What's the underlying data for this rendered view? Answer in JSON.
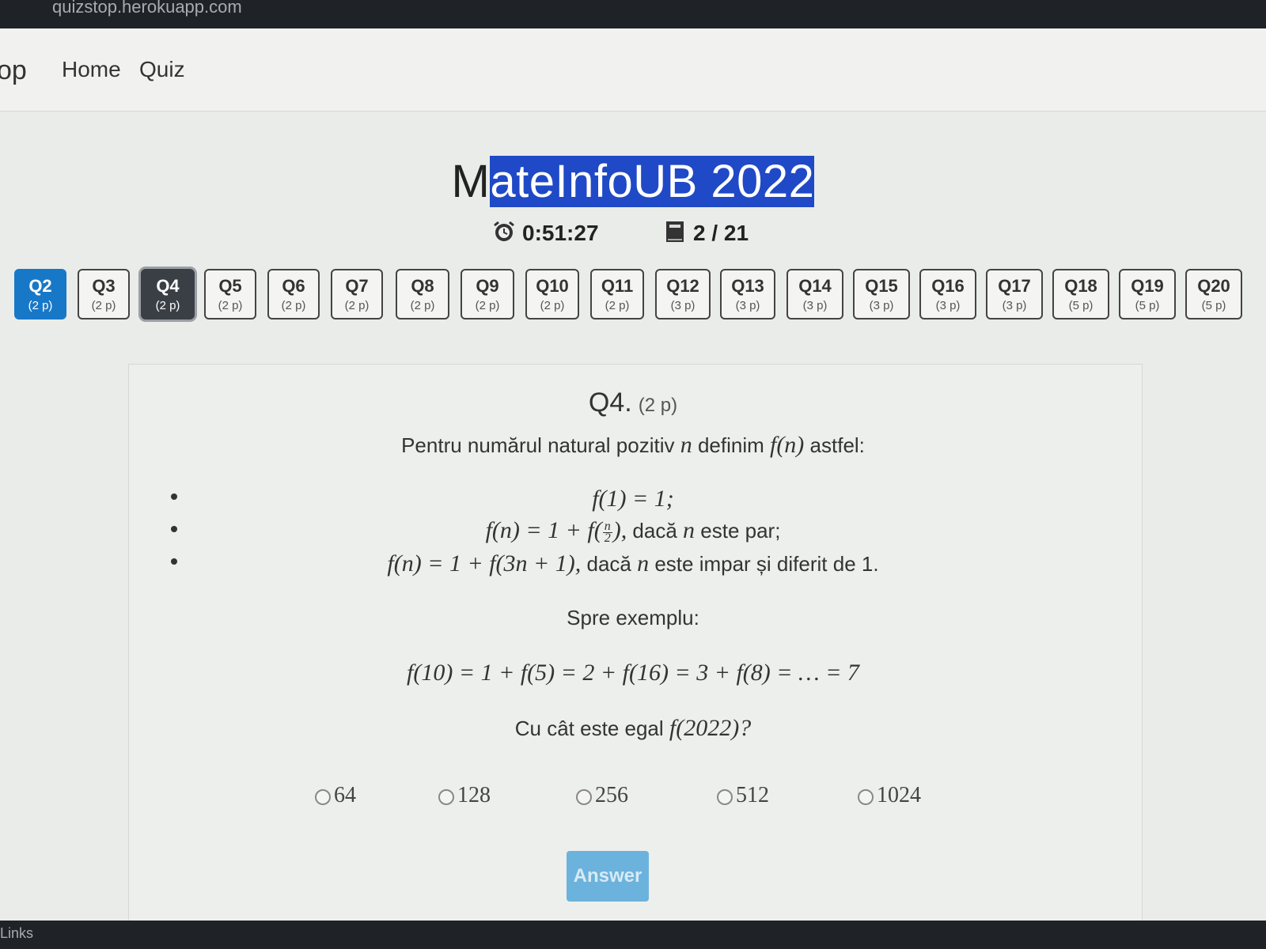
{
  "browser": {
    "url": "quizstop.herokuapp.com"
  },
  "navbar": {
    "brand": "op",
    "links": [
      "Home",
      "Quiz"
    ]
  },
  "quiz": {
    "title_prefix": "M",
    "title_selected": "ateInfoUB 2022",
    "timer": "0:51:27",
    "progress": "2 / 21"
  },
  "questions_nav": [
    {
      "label": "Q2",
      "points": "(2 p)",
      "state": "answered"
    },
    {
      "label": "Q3",
      "points": "(2 p)",
      "state": "default"
    },
    {
      "label": "Q4",
      "points": "(2 p)",
      "state": "current"
    },
    {
      "label": "Q5",
      "points": "(2 p)",
      "state": "default"
    },
    {
      "label": "Q6",
      "points": "(2 p)",
      "state": "default"
    },
    {
      "label": "Q7",
      "points": "(2 p)",
      "state": "default"
    },
    {
      "label": "Q8",
      "points": "(2 p)",
      "state": "default"
    },
    {
      "label": "Q9",
      "points": "(2 p)",
      "state": "default"
    },
    {
      "label": "Q10",
      "points": "(2 p)",
      "state": "default"
    },
    {
      "label": "Q11",
      "points": "(2 p)",
      "state": "default"
    },
    {
      "label": "Q12",
      "points": "(3 p)",
      "state": "default"
    },
    {
      "label": "Q13",
      "points": "(3 p)",
      "state": "default"
    },
    {
      "label": "Q14",
      "points": "(3 p)",
      "state": "default"
    },
    {
      "label": "Q15",
      "points": "(3 p)",
      "state": "default"
    },
    {
      "label": "Q16",
      "points": "(3 p)",
      "state": "default"
    },
    {
      "label": "Q17",
      "points": "(3 p)",
      "state": "default"
    },
    {
      "label": "Q18",
      "points": "(5 p)",
      "state": "default"
    },
    {
      "label": "Q19",
      "points": "(5 p)",
      "state": "default"
    },
    {
      "label": "Q20",
      "points": "(5 p)",
      "state": "default"
    }
  ],
  "question": {
    "number": "Q4.",
    "points": "(2 p)",
    "intro_a": "Pentru numărul natural pozitiv ",
    "intro_n": "n",
    "intro_b": " definim ",
    "intro_f": "f(n)",
    "intro_c": " astfel:",
    "rule1": "f(1) = 1;",
    "rule2_a": "f(n) = 1 + f(",
    "rule2_num": "n",
    "rule2_den": "2",
    "rule2_b": "),",
    "rule2_c": " dacă ",
    "rule2_n": "n",
    "rule2_d": " este par;",
    "rule3_a": "f(n) = 1 + f(3n + 1),",
    "rule3_b": " dacă ",
    "rule3_n": "n",
    "rule3_c": " este impar și diferit de 1.",
    "example_label": "Spre exemplu:",
    "example": "f(10) = 1 + f(5) = 2 + f(16) = 3 + f(8) = … = 7",
    "ask_a": "Cu cât este egal ",
    "ask_f": "f(2022)?",
    "options": [
      "64",
      "128",
      "256",
      "512",
      "1024"
    ],
    "answer_button": "Answer"
  },
  "taskbar": {
    "links_label": "Links"
  },
  "colors": {
    "answered": "#1878c8",
    "current": "#3a3f45",
    "selection": "#1f49c6",
    "answer_button": "#6bb3dc"
  }
}
